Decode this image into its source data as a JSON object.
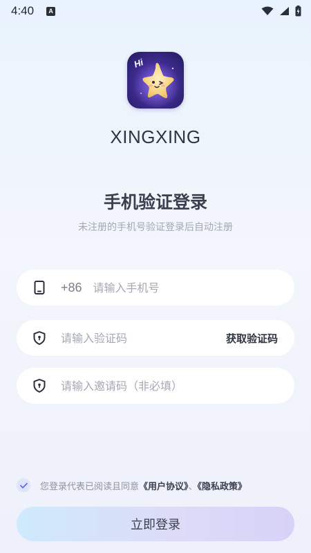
{
  "status_bar": {
    "time": "4:40",
    "notification_icon_letter": "A"
  },
  "app": {
    "brand_name": "XINGXING",
    "logo_badge": "Hi"
  },
  "login": {
    "title": "手机验证登录",
    "subtitle": "未注册的手机号验证登录后自动注册",
    "phone": {
      "prefix": "+86",
      "placeholder": "请输入手机号"
    },
    "code": {
      "placeholder": "请输入验证码",
      "get_code_label": "获取验证码"
    },
    "invite": {
      "placeholder": "请输入邀请码（非必填）"
    },
    "agreement": {
      "checked": true,
      "prefix_text": "您登录代表已阅读且同意",
      "user_agreement": "《用户协议》",
      "separator": "、",
      "privacy_policy": "《隐私政策》"
    },
    "submit_label": "立即登录"
  },
  "colors": {
    "background_top": "#e9f3fd",
    "background_bottom": "#eef0fb",
    "button_gradient_start": "#cfeafd",
    "button_gradient_end": "#d7d2f7",
    "logo_background": "#3b2a8a",
    "star": "#f7d98a",
    "check_mark": "#5b6cf0"
  }
}
